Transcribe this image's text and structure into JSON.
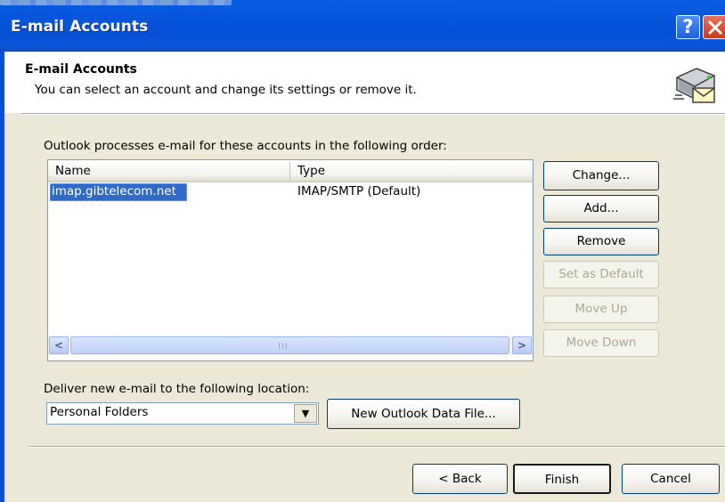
{
  "window": {
    "title": "E-mail Accounts",
    "help_glyph": "?",
    "close_icon": "close-icon"
  },
  "header": {
    "title": "E-mail Accounts",
    "subtitle": "You can select an account and change its settings or remove it.",
    "icon": "email-account-icon"
  },
  "accounts": {
    "label": "Outlook processes e-mail for these accounts in the following order:",
    "columns": [
      "Name",
      "Type"
    ],
    "rows": [
      {
        "name": "imap.gibtelecom.net",
        "type": "IMAP/SMTP (Default)",
        "selected": true
      }
    ],
    "scroll_left": "<",
    "scroll_right": ">",
    "thumb_grip": "III"
  },
  "side_buttons": {
    "change": "Change...",
    "add": "Add...",
    "remove": "Remove",
    "set_default": "Set as Default",
    "move_up": "Move Up",
    "move_down": "Move Down"
  },
  "delivery": {
    "label": "Deliver new e-mail to the following location:",
    "selected": "Personal Folders",
    "dropdown_arrow": "▼",
    "new_data_file": "New Outlook Data File..."
  },
  "footer": {
    "back": "< Back",
    "finish": "Finish",
    "cancel": "Cancel"
  },
  "colors": {
    "titlebar": "#0a55d8",
    "selection": "#316ac5",
    "dialog_bg": "#ece9d8",
    "close_red": "#d8502f"
  }
}
